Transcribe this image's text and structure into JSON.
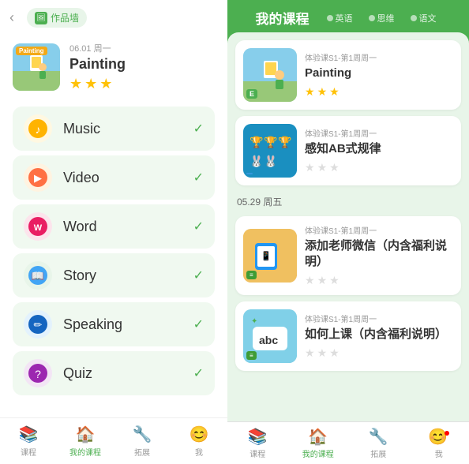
{
  "left": {
    "back_arrow": "‹",
    "portfolio_label": "作品墙",
    "featured": {
      "date": "06.01 周一",
      "title": "Painting",
      "stars": [
        true,
        true,
        true
      ],
      "thumb_label": "Painting"
    },
    "menu_items": [
      {
        "id": "music",
        "label": "Music",
        "icon": "🎵",
        "bg": "#fff8e1",
        "checked": true
      },
      {
        "id": "video",
        "label": "Video",
        "icon": "📺",
        "bg": "#fff3e0",
        "checked": true
      },
      {
        "id": "word",
        "label": "Word",
        "icon": "🔤",
        "bg": "#fce4ec",
        "checked": true
      },
      {
        "id": "story",
        "label": "Story",
        "icon": "📖",
        "bg": "#e8f5e9",
        "checked": true
      },
      {
        "id": "speaking",
        "label": "Speaking",
        "icon": "✏️",
        "bg": "#e3f2fd",
        "checked": true
      },
      {
        "id": "quiz",
        "label": "Quiz",
        "icon": "❓",
        "bg": "#f3e5f5",
        "checked": true
      }
    ],
    "bottom_nav": [
      {
        "id": "course",
        "icon": "📚",
        "label": "课程"
      },
      {
        "id": "my-course",
        "icon": "🏠",
        "label": "我的课程",
        "active": true
      },
      {
        "id": "expand",
        "icon": "🔧",
        "label": "拓展"
      },
      {
        "id": "profile",
        "icon": "😊",
        "label": "我"
      }
    ]
  },
  "right": {
    "title": "我的课程",
    "tabs": [
      {
        "label": "英语"
      },
      {
        "label": "思维"
      },
      {
        "label": "语文"
      }
    ],
    "courses": [
      {
        "subtitle": "体验课S1-第1周周一",
        "title": "Painting",
        "stars": [
          true,
          true,
          true
        ],
        "thumb_type": "painting",
        "badge": "E"
      },
      {
        "subtitle": "体验课S1-第1周周一",
        "title": "感知AB式规律",
        "stars": [
          false,
          false,
          false
        ],
        "thumb_type": "pattern",
        "badge": ""
      }
    ],
    "date_separator": "05.29 周五",
    "courses2": [
      {
        "subtitle": "体验课S1-第1周周一",
        "title": "添加老师微信（内含福利说明）",
        "stars": [
          false,
          false,
          false
        ],
        "thumb_type": "wechat",
        "badge": ""
      },
      {
        "subtitle": "体验课S1-第1周周一",
        "title": "如何上课（内含福利说明）",
        "stars": [
          false,
          false,
          false
        ],
        "thumb_type": "howto",
        "badge": ""
      }
    ],
    "bottom_nav": [
      {
        "id": "course",
        "icon": "📚",
        "label": "课程"
      },
      {
        "id": "my-course",
        "icon": "🏠",
        "label": "我的课程",
        "active": true
      },
      {
        "id": "expand",
        "icon": "🔧",
        "label": "拓展"
      },
      {
        "id": "profile",
        "icon": "😊",
        "label": "我",
        "badge": true
      }
    ]
  }
}
